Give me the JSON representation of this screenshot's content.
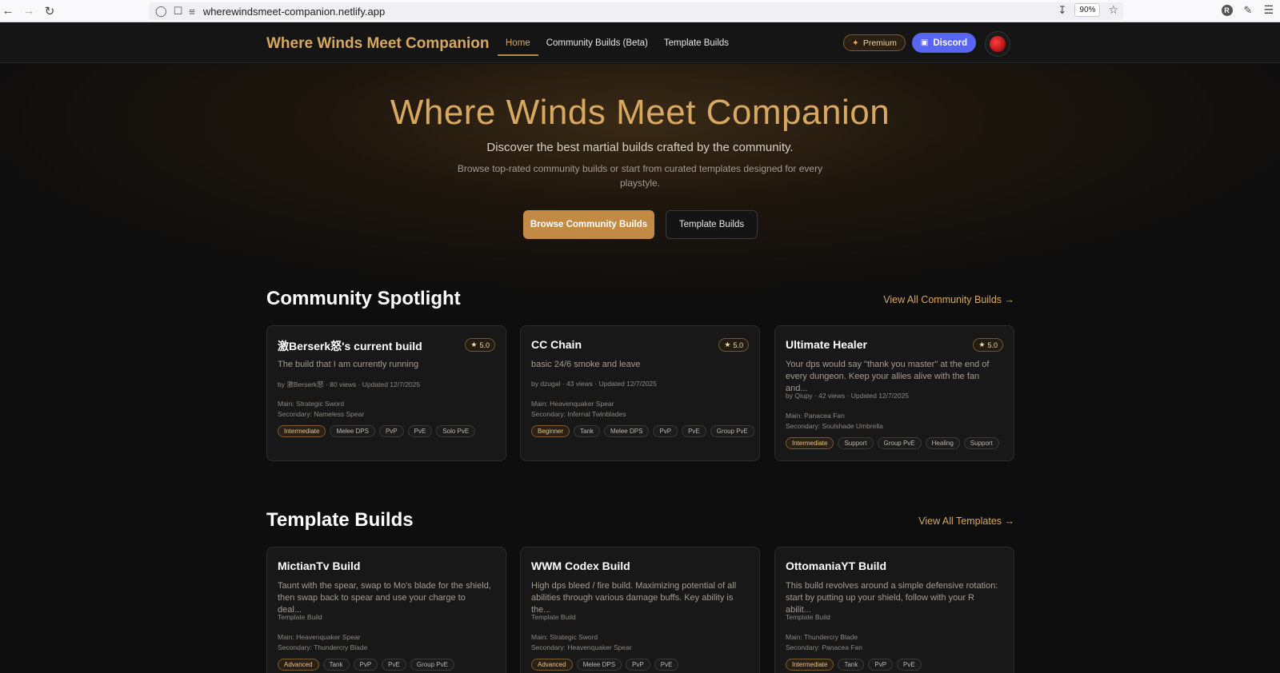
{
  "browser": {
    "url": "wherewindsmeet-companion.netlify.app",
    "zoom": "90%",
    "profile_initial": "R"
  },
  "nav": {
    "logo": "Where Winds Meet Companion",
    "links": [
      "Home",
      "Community Builds (Beta)",
      "Template Builds"
    ],
    "premium": "Premium",
    "discord": "Discord"
  },
  "hero": {
    "title": "Where Winds Meet Companion",
    "subtitle": "Discover the best martial builds crafted by the community.",
    "description": "Browse top-rated community builds or start from curated templates designed for every playstyle.",
    "primary_button": "Browse Community Builds",
    "secondary_button": "Template Builds"
  },
  "spotlight": {
    "title": "Community Spotlight",
    "view_all": "View All Community Builds →",
    "cards": [
      {
        "title": "激Berserk怒's current build",
        "rating": "5.0",
        "desc": "The build that I am currently running",
        "meta": "by 激Berserk怒 · 80 views · Updated 12/7/2025",
        "main": "Main: Strategic Sword",
        "secondary": "Secondary: Nameless Spear",
        "level": "Intermediate",
        "tags": [
          "Melee DPS",
          "PvP",
          "PvE",
          "Solo PvE"
        ]
      },
      {
        "title": "CC Chain",
        "rating": "5.0",
        "desc": "basic 24/6 smoke and leave",
        "meta": "by dzugal · 43 views · Updated 12/7/2025",
        "main": "Main: Heavenquaker Spear",
        "secondary": "Secondary: Infernal Twinblades",
        "level": "Beginner",
        "tags": [
          "Tank",
          "Melee DPS",
          "PvP",
          "PvE",
          "Group PvE"
        ]
      },
      {
        "title": "Ultimate Healer",
        "rating": "5.0",
        "desc": "Your dps would say \"thank you master\" at the end of every dungeon. Keep your allies alive with the fan and...",
        "meta": "by Qiupy · 42 views · Updated 12/7/2025",
        "main": "Main: Panacea Fan",
        "secondary": "Secondary: Soulshade Umbrella",
        "level": "Intermediate",
        "tags": [
          "Support",
          "Group PvE",
          "Healing",
          "Support"
        ]
      }
    ]
  },
  "templates": {
    "title": "Template Builds",
    "view_all": "View All Templates →",
    "cards": [
      {
        "title": "MictianTv Build",
        "desc": "Taunt with the spear, swap to Mo's blade for the shield, then swap back to spear and use your charge to deal...",
        "meta": "Template Build",
        "main": "Main: Heavenquaker Spear",
        "secondary": "Secondary: Thundercry Blade",
        "level": "Advanced",
        "tags": [
          "Tank",
          "PvP",
          "PvE",
          "Group PvE"
        ]
      },
      {
        "title": "WWM Codex Build",
        "desc": "High dps bleed / fire build. Maximizing potential of all abilities through various damage buffs. Key ability is the...",
        "meta": "Template Build",
        "main": "Main: Strategic Sword",
        "secondary": "Secondary: Heavenquaker Spear",
        "level": "Advanced",
        "tags": [
          "Melee DPS",
          "PvP",
          "PvE"
        ]
      },
      {
        "title": "OttomaniaYT Build",
        "desc": "This build revolves around a simple defensive rotation: start by putting up your shield, follow with your R abilit...",
        "meta": "Template Build",
        "main": "Main: Thundercry Blade",
        "secondary": "Secondary: Panacea Fan",
        "level": "Intermediate",
        "tags": [
          "Tank",
          "PvP",
          "PvE"
        ]
      }
    ]
  }
}
